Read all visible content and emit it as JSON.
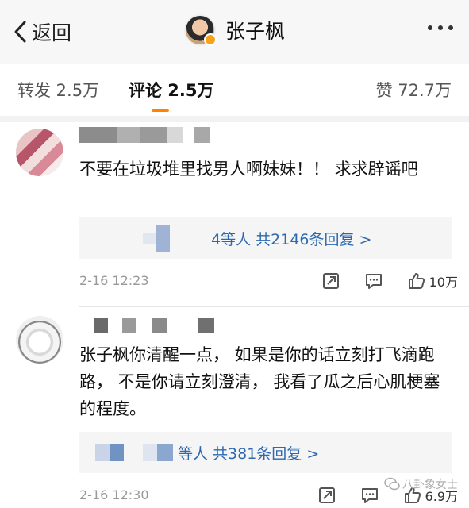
{
  "navbar": {
    "back_label": "返回",
    "title": "张子枫"
  },
  "tabs": {
    "repost": "转发 2.5万",
    "comment": "评论 2.5万",
    "like": "赞 72.7万"
  },
  "comments": [
    {
      "text": "不要在垃圾堆里找男人啊妹妹！！ 求求辟谣吧",
      "reply_summary": "4等人  共2146条回复 >",
      "time": "2-16 12:23",
      "like_count": "10万"
    },
    {
      "text": "张子枫你清醒一点， 如果是你的话立刻打飞滴跑路， 不是你请立刻澄清， 我看了瓜之后心肌梗塞的程度。",
      "reply_summary": "等人  共381条回复 >",
      "time": "2-16 12:30",
      "like_count": "6.9万"
    }
  ],
  "watermark": "八卦象女士",
  "colors": {
    "accent": "#ff8200",
    "link": "#2d69b1",
    "navbar_bg": "#f7f7f7",
    "reply_bg": "#f5f5f5"
  }
}
